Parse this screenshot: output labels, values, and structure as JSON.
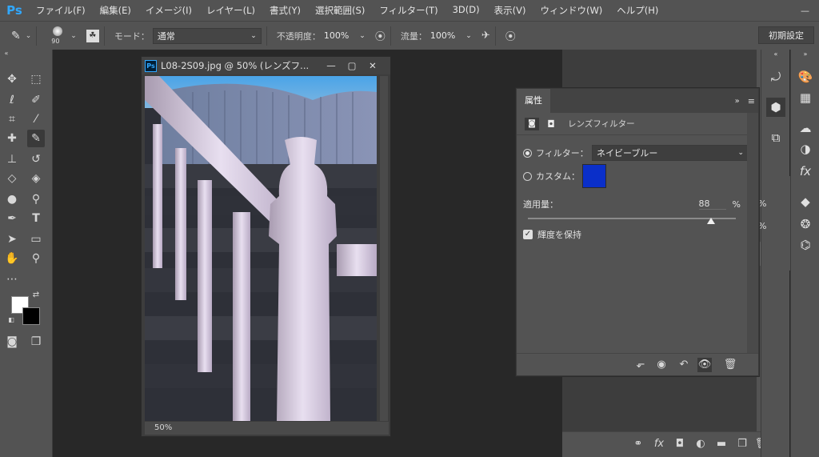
{
  "app": {
    "logo": "Ps"
  },
  "menu": [
    "ファイル(F)",
    "編集(E)",
    "イメージ(I)",
    "レイヤー(L)",
    "書式(Y)",
    "選択範囲(S)",
    "フィルター(T)",
    "3D(D)",
    "表示(V)",
    "ウィンドウ(W)",
    "ヘルプ(H)"
  ],
  "options": {
    "brush_size": "90",
    "mode_label": "モード：",
    "mode_value": "通常",
    "opacity_label": "不透明度：",
    "opacity_value": "100%",
    "flow_label": "流量：",
    "flow_value": "100%",
    "preset": "初期設定"
  },
  "document": {
    "title": "L08-2S09.jpg @ 50% (レンズフ...",
    "zoom": "50%"
  },
  "properties": {
    "tab": "属性",
    "header": "レンズフィルター",
    "filter_label": "フィルター：",
    "filter_value": "ネイビーブルー",
    "custom_label": "カスタム：",
    "custom_color": "#0a2fc9",
    "density_label": "適用量：",
    "density_value": "88",
    "density_unit": "%",
    "density_level": 0.88,
    "preserve_label": "輝度を保持"
  },
  "colors": {
    "accent": "#31a8ff",
    "ui_bg": "#535353",
    "workspace": "#282828"
  },
  "icons": [
    "brush-icon",
    "move-icon",
    "marquee-icon",
    "lasso-icon",
    "quick-select-icon",
    "crop-icon",
    "eyedropper-icon",
    "healing-icon",
    "brush-tool-icon",
    "stamp-icon",
    "history-brush-icon",
    "eraser-icon",
    "bucket-icon",
    "blur-icon",
    "dodge-icon",
    "pen-icon",
    "type-icon",
    "path-select-icon",
    "shape-icon",
    "hand-icon",
    "zoom-icon"
  ]
}
